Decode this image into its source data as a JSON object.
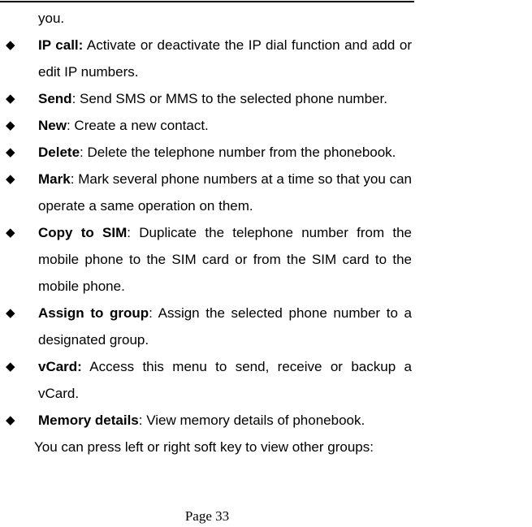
{
  "document": {
    "continuation_text": "you.",
    "bullet_glyph": "◆",
    "items": [
      {
        "term": "IP call:",
        "desc": " Activate or deactivate the IP dial function and add or edit IP numbers."
      },
      {
        "term": "Send",
        "desc": ": Send SMS or MMS to the selected phone number."
      },
      {
        "term": "New",
        "desc": ": Create a new contact."
      },
      {
        "term": "Delete",
        "desc": ": Delete the telephone number from the phonebook."
      },
      {
        "term": "Mark",
        "desc": ": Mark several phone numbers at a time so that you can operate a same operation on them."
      },
      {
        "term": "Copy to SIM",
        "desc": ": Duplicate the telephone number from the mobile phone to the SIM card or from the SIM card to the mobile phone."
      },
      {
        "term": "Assign to group",
        "desc": ": Assign the selected phone number to a designated group."
      },
      {
        "term": "vCard:",
        "desc": " Access this menu to send, receive or backup a vCard."
      },
      {
        "term": "Memory details",
        "desc": ": View memory details of phonebook."
      }
    ],
    "closing_text": "You can press left or right soft key to view other groups:",
    "page_label": "Page 33"
  }
}
